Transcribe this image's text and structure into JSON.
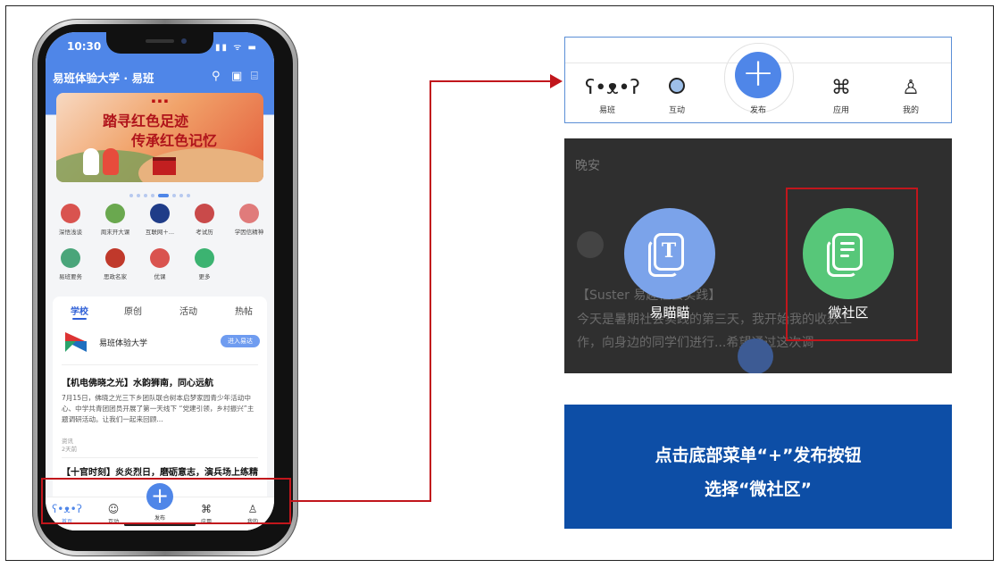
{
  "phone": {
    "status_time": "10:30",
    "status_icons": "▮▮ ᯤ ▬",
    "app_title": "易班体验大学 · 易班",
    "banner": {
      "line1": "踏寻红色足迹",
      "line2": "传承红色记忆"
    },
    "grid_items": [
      {
        "label": "深悟浅谈",
        "color": "#d9534f"
      },
      {
        "label": "周末开大课",
        "color": "#6aa84f"
      },
      {
        "label": "互联网＋...",
        "color": "#1f3c88"
      },
      {
        "label": "考试历",
        "color": "#c94a4a"
      },
      {
        "label": "学因信精神",
        "color": "#e07b7b"
      },
      {
        "label": "易班要务",
        "color": "#4aa57a"
      },
      {
        "label": "思政名家",
        "color": "#c0392b"
      },
      {
        "label": "优课",
        "color": "#d9534f"
      },
      {
        "label": "更多",
        "color": "#3cb371"
      }
    ],
    "feed_tabs": [
      {
        "label": "学校"
      },
      {
        "label": "原创"
      },
      {
        "label": "活动"
      },
      {
        "label": "热帖"
      }
    ],
    "school": {
      "name": "易班体验大学",
      "enter_label": "进入易达"
    },
    "post": {
      "title": "【机电佛晓之光】水韵狮南，同心远航",
      "body": "7月15日，佛晓之光三下乡团队联合树本启梦家园青少年活动中心、中学共青团团员开展了第一天线下 “党建引领，乡村振兴”主题调研活动。让我们一起来回顾...",
      "meta1": "资讯",
      "meta2": "2天前",
      "next_title": "【十官时刻】炎炎烈日，磨砺意志，演兵场上练精"
    },
    "tabbar": [
      {
        "label": "首页",
        "icon": "bear-icon"
      },
      {
        "label": "互动",
        "icon": "smile-icon"
      },
      {
        "label": "发布",
        "icon": "plus-icon"
      },
      {
        "label": "应用",
        "icon": "command-icon"
      },
      {
        "label": "我的",
        "icon": "person-icon"
      }
    ]
  },
  "tabbar_zoom": {
    "items": [
      {
        "label": "易班"
      },
      {
        "label": "互动"
      },
      {
        "label": "发布"
      },
      {
        "label": "应用"
      },
      {
        "label": "我的"
      }
    ],
    "plus": "+"
  },
  "popup": {
    "greeting": "晚安",
    "bg_line1": "【Suster 易趣社会实践】",
    "bg_line2": "今天是暑期社会实践的第三天，我开始我的收获工",
    "bg_line3": "作，向身边的同学们进行...希望通过这次调",
    "option1": {
      "label": "易瞄瞄",
      "icon": "t-doc-icon",
      "color": "#7ba3ea"
    },
    "option2": {
      "label": "微社区",
      "icon": "list-doc-icon",
      "color": "#57c779"
    }
  },
  "instruction": {
    "line1": "点击底部菜单“+”发布按钮",
    "line2": "选择“微社区”"
  },
  "colors": {
    "accent": "#4f86e8",
    "highlight": "#c1161c",
    "instruction_bg": "#0d4ea6"
  }
}
